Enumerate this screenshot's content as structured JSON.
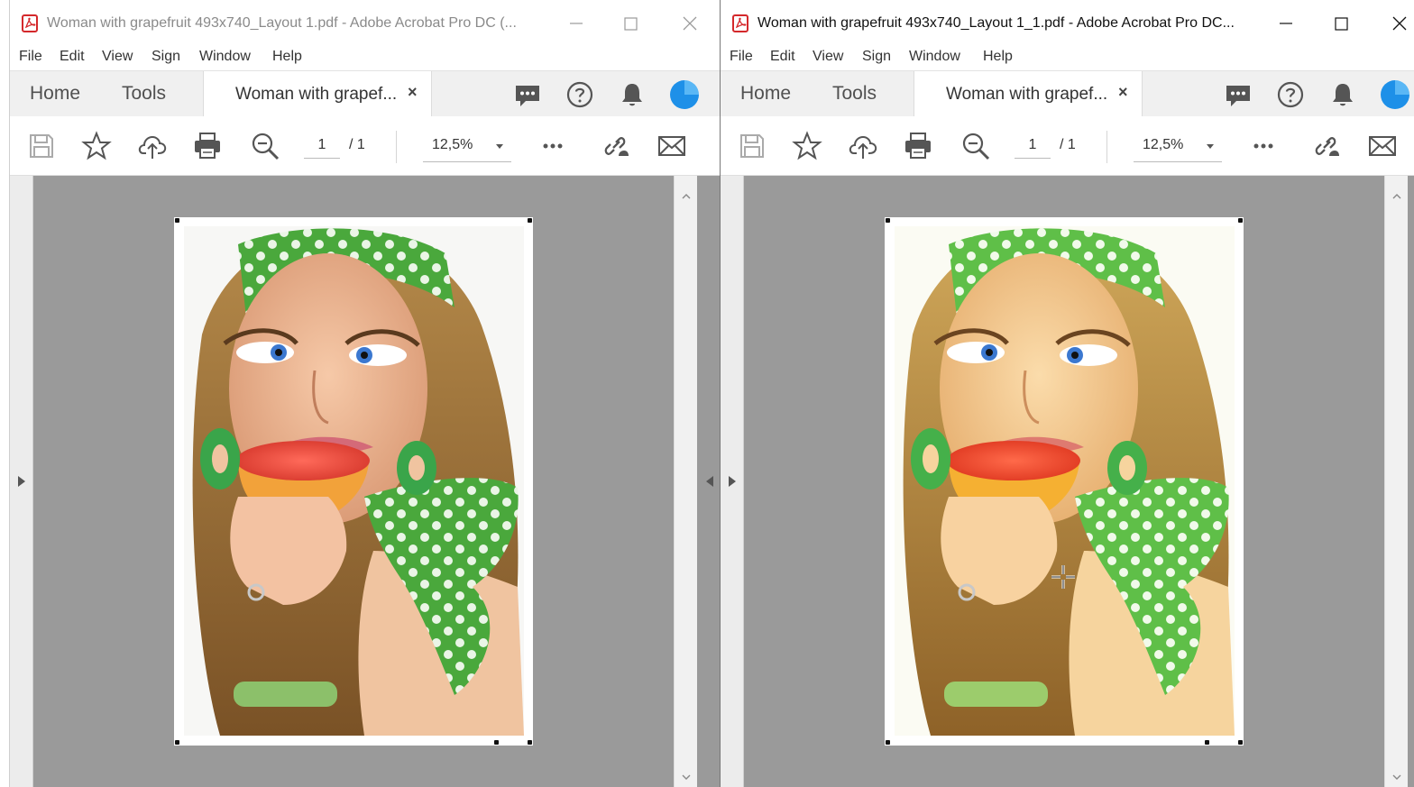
{
  "windows": [
    {
      "title": "Woman with grapefruit 493x740_Layout 1.pdf - Adobe Acrobat Pro DC (...",
      "active": false,
      "menu": [
        "File",
        "Edit",
        "View",
        "Sign",
        "Window",
        "Help"
      ],
      "nav_tabs": [
        "Home",
        "Tools"
      ],
      "doc_tab": {
        "label": "Woman with grapef...",
        "close": "×"
      },
      "page_current": "1",
      "page_total": "/ 1",
      "zoom": "12,5%"
    },
    {
      "title": "Woman with grapefruit 493x740_Layout 1_1.pdf - Adobe Acrobat Pro DC...",
      "active": true,
      "menu": [
        "File",
        "Edit",
        "View",
        "Sign",
        "Window",
        "Help"
      ],
      "nav_tabs": [
        "Home",
        "Tools"
      ],
      "doc_tab": {
        "label": "Woman with grapef...",
        "close": "×"
      },
      "page_current": "1",
      "page_total": "/ 1",
      "zoom": "12,5%"
    }
  ],
  "colors": {
    "acrobat_red": "#d4282b",
    "doc_background": "#9a9a9a",
    "avatar_blue": "#1e90e8",
    "scarf_green": "#4aa83c",
    "grapefruit_red": "#e8403a"
  }
}
